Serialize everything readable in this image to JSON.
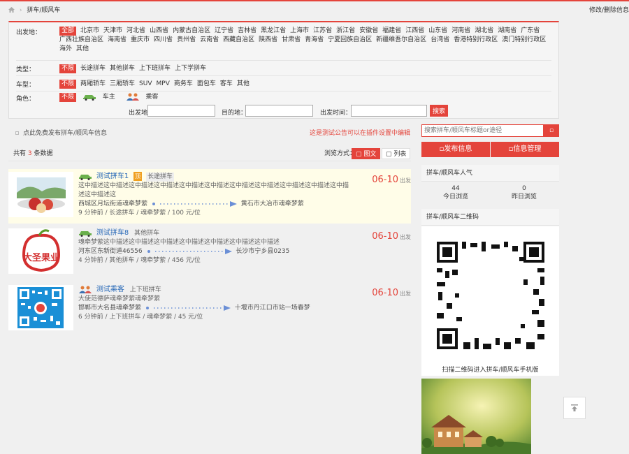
{
  "breadcrumb": {
    "current": "拼车/顺风车",
    "edit": "修改/删除信息"
  },
  "filters": {
    "departure_label": "出发地：",
    "departure_options": [
      "全部",
      "北京市",
      "天津市",
      "河北省",
      "山西省",
      "内蒙古自治区",
      "辽宁省",
      "吉林省",
      "黑龙江省",
      "上海市",
      "江苏省",
      "浙江省",
      "安徽省",
      "福建省",
      "江西省",
      "山东省",
      "河南省",
      "湖北省",
      "湖南省",
      "广东省",
      "广西壮族自治区",
      "海南省",
      "重庆市",
      "四川省",
      "贵州省",
      "云南省",
      "西藏自治区",
      "陕西省",
      "甘肃省",
      "青海省",
      "宁夏回族自治区",
      "新疆维吾尔自治区",
      "台湾省",
      "香港特别行政区",
      "澳门特别行政区",
      "海外",
      "其他"
    ],
    "type_label": "类型：",
    "type_options": [
      "不限",
      "长途拼车",
      "其他拼车",
      "上下班拼车",
      "上下学拼车"
    ],
    "cartype_label": "车型：",
    "cartype_options": [
      "不限",
      "两厢轿车",
      "三厢轿车",
      "SUV",
      "MPV",
      "商务车",
      "面包车",
      "客车",
      "其他"
    ],
    "role_label": "角色：",
    "role_any": "不限",
    "role_driver": "车主",
    "role_passenger": "乘客",
    "from_label": "出发地",
    "to_label": "目的地：",
    "time_label": "出发时间：",
    "search_btn": "搜索"
  },
  "main": {
    "free_post": "点此免费发布拼车/顺风车信息",
    "notice": "这是测试公告可以在插件设置中编辑",
    "count_prefix": "共有",
    "count": "3",
    "count_suffix": "条数据",
    "view_label": "浏览方式：",
    "view_graphic": "图文",
    "view_list": "列表"
  },
  "listings": [
    {
      "title": "测试拼车1",
      "ding": "顶",
      "category": "长途拼车",
      "desc": "这中描述这中描述这中描述这中描述这中描述这中描述这中描述这中描述这中描述这中描述这中描述这中描述这",
      "from": "西城区月坛街道魂牵梦萦",
      "to": "黄石市大冶市魂牵梦萦",
      "meta": "9 分钟前 / 长途拼车 / 魂牵梦萦 / 100 元/位",
      "date": "06-10",
      "date_suffix": "出发"
    },
    {
      "title": "测试拼车8",
      "category": "其他拼车",
      "desc": "魂牵梦萦这中描述这中描述这中描述这中描述这中描述这中描述这中描述",
      "from": "河东区东新街道46556",
      "to": "长沙市宁乡县0235",
      "meta": "4 分钟前 / 其他拼车 / 魂牵梦萦 / 456 元/位",
      "date": "06-10",
      "date_suffix": "出发",
      "logo_text": "大圣果业"
    },
    {
      "title": "测试乘客",
      "category": "上下班拼车",
      "desc": "大使范德萨魂牵梦萦魂牵梦萦",
      "from": "邯郸市大名县魂牵梦萦",
      "to": "十堰市丹江口市站一场春梦",
      "meta": "6 分钟前 / 上下班拼车 / 魂牵梦萦 / 45 元/位",
      "date": "06-10",
      "date_suffix": "出发"
    }
  ],
  "sidebar": {
    "search_placeholder": "搜索拼车/顺风车标题or途径",
    "post_btn": "发布信息",
    "manage_btn": "信息管理",
    "popular_title": "拼车/顺风车人气",
    "today_count": "44",
    "today_label": "今日浏览",
    "yesterday_count": "0",
    "yesterday_label": "昨日浏览",
    "qr_title": "拼车/顺风车二维码",
    "qr_caption": "扫描二维码进入拼车/顺风车手机版"
  },
  "colors": {
    "accent": "#e4443b",
    "link": "#2a6ab8"
  }
}
